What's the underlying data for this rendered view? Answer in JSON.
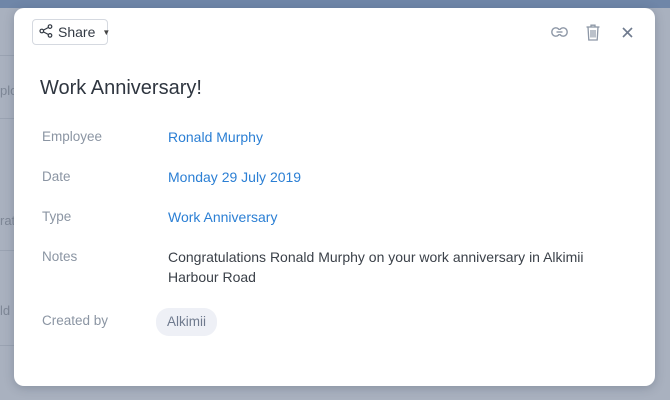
{
  "background": {
    "fragments": [
      "plo",
      "rat",
      "ld"
    ]
  },
  "toolbar": {
    "share_label": "Share",
    "icons": [
      "share-icon",
      "caret-down-icon",
      "link-icon",
      "trash-icon",
      "close-icon"
    ]
  },
  "modal": {
    "title": "Work Anniversary!",
    "fields": [
      {
        "label": "Employee",
        "value": "Ronald Murphy"
      },
      {
        "label": "Date",
        "value": "Monday 29 July 2019"
      },
      {
        "label": "Type",
        "value": "Work Anniversary"
      },
      {
        "label": "Notes",
        "value_line1": "Congratulations Ronald Murphy on your work anniversary in Alkimii",
        "value_line2": "Harbour Road"
      },
      {
        "label": "Created by",
        "value": "Alkimii"
      }
    ]
  },
  "colors": {
    "accent": "#2b7fd4",
    "label": "#8b95a3",
    "chip_bg": "#eef0f6"
  }
}
